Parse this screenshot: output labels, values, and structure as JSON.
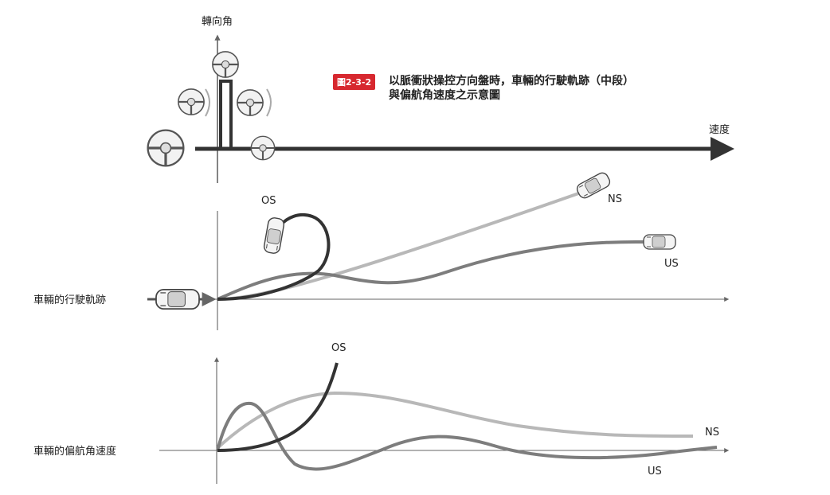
{
  "axes": {
    "steering_angle_label": "轉向角",
    "speed_label": "速度"
  },
  "caption": {
    "badge": "圖2-3-2",
    "line1": "以脈衝狀操控方向盤時，車輛的行駛軌跡（中段）",
    "line2": "與偏航角速度之示意圖"
  },
  "rows": {
    "trajectory_label": "車輛的行駛軌跡",
    "yaw_rate_label": "車輛的偏航角速度"
  },
  "curve_labels": {
    "os_traj": "OS",
    "ns_traj": "NS",
    "us_traj": "US",
    "os_yaw": "OS",
    "ns_yaw": "NS",
    "us_yaw": "US"
  },
  "colors": {
    "os": "#333333",
    "ns": "#b8b8b8",
    "us": "#7d7d7d",
    "axis": "#333333",
    "badge": "#d7282f"
  },
  "icons": [
    "steering-wheel-icon",
    "car-icon"
  ]
}
